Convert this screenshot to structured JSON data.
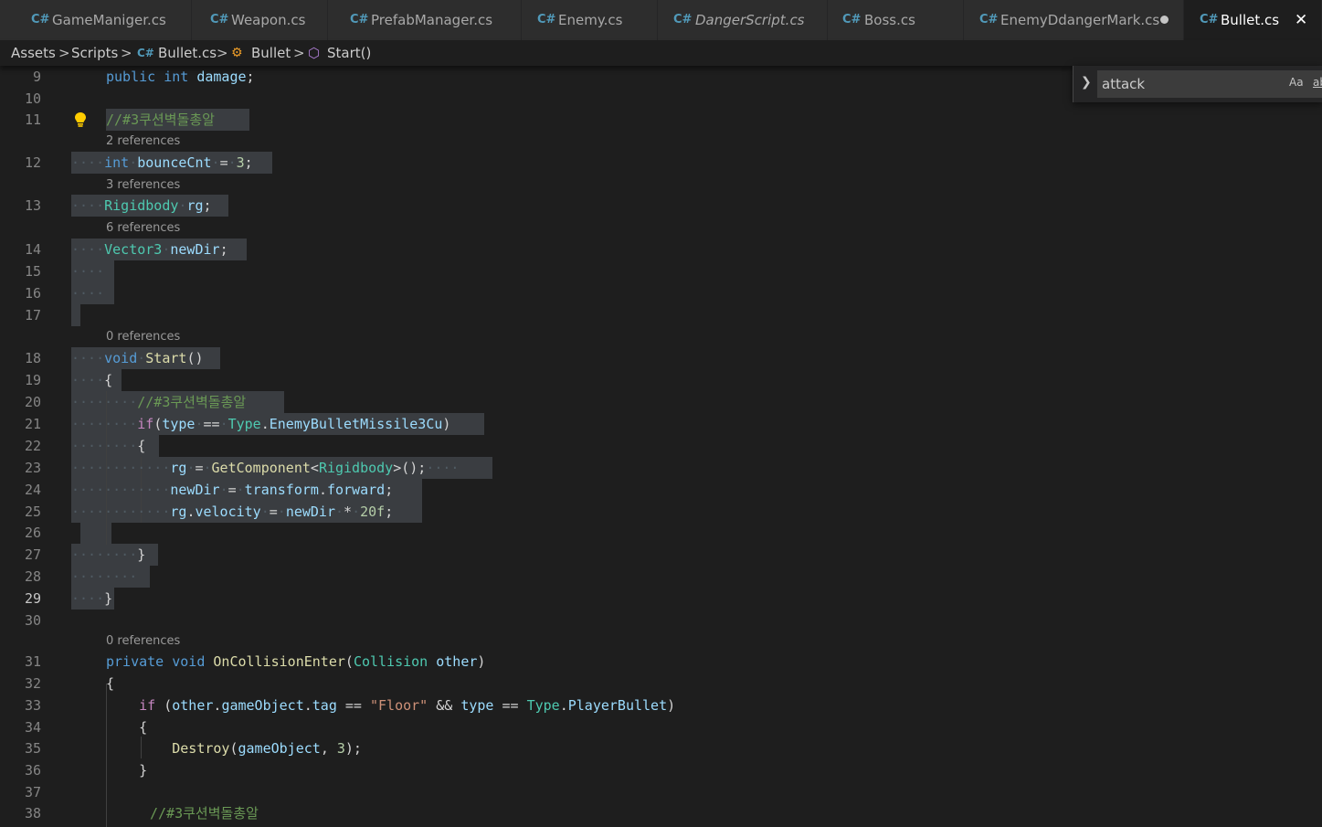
{
  "tabs": [
    {
      "label": "GameManiger.cs",
      "italic": false,
      "active": false
    },
    {
      "label": "Weapon.cs",
      "italic": false,
      "active": false
    },
    {
      "label": "PrefabManager.cs",
      "italic": false,
      "active": false
    },
    {
      "label": "Enemy.cs",
      "italic": false,
      "active": false
    },
    {
      "label": "DangerScript.cs",
      "italic": true,
      "active": false
    },
    {
      "label": "Boss.cs",
      "italic": false,
      "active": false
    },
    {
      "label": "EnemyDdangerMark.cs",
      "italic": false,
      "active": false,
      "modified": true
    },
    {
      "label": "Bullet.cs",
      "italic": false,
      "active": true
    }
  ],
  "tab_close_glyph": "✕",
  "file_icon_text": "C#",
  "breadcrumb": {
    "assets": "Assets",
    "scripts": "Scripts",
    "file": "Bullet.cs",
    "class_name": "Bullet",
    "method": "Start()",
    "separator": ">"
  },
  "find_widget": {
    "value": "attack",
    "match_case_label": "Aa",
    "whole_word_label": "ab"
  },
  "code_lens": {
    "l12": "2 references",
    "l13": "3 references",
    "l14": "6 references",
    "l18": "0 references",
    "l31": "0 references"
  },
  "line_numbers": [
    "9",
    "10",
    "11",
    "12",
    "13",
    "14",
    "15",
    "16",
    "17",
    "18",
    "19",
    "20",
    "21",
    "22",
    "23",
    "24",
    "25",
    "26",
    "27",
    "28",
    "29",
    "30",
    "31",
    "32",
    "33",
    "34",
    "35",
    "36",
    "37",
    "38"
  ],
  "tokens": {
    "l9_kw1": "public",
    "l9_kw2": "int",
    "l9_id": "damage",
    "l11_comment": "//#3쿠션벽돌총알",
    "l12_kw": "int",
    "l12_id": "bounceCnt",
    "l12_num": "3",
    "l13_type": "Rigidbody",
    "l13_id": "rg",
    "l14_type": "Vector3",
    "l14_id": "newDir",
    "l18_kw": "void",
    "l18_fn": "Start",
    "l20_comment": "//#3쿠션벽돌총알",
    "l21_if": "if",
    "l21_type_field": "type",
    "l21_type_class": "Type",
    "l21_member": "EnemyBulletMissile3Cu",
    "l23_id": "rg",
    "l23_fn": "GetComponent",
    "l23_type": "Rigidbody",
    "l24_id": "newDir",
    "l24_obj": "transform",
    "l24_member": "forward",
    "l25_id": "rg",
    "l25_member": "velocity",
    "l25_id2": "newDir",
    "l25_num": "20f",
    "l31_kw1": "private",
    "l31_kw2": "void",
    "l31_fn": "OnCollisionEnter",
    "l31_type": "Collision",
    "l31_param": "other",
    "l33_if": "if",
    "l33_other": "other",
    "l33_go": "gameObject",
    "l33_tag": "tag",
    "l33_str": "\"Floor\"",
    "l33_type_field": "type",
    "l33_type_class": "Type",
    "l33_member": "PlayerBullet",
    "l35_fn": "Destroy",
    "l35_arg": "gameObject",
    "l35_num": "3",
    "l38_comment": "//#3쿠션벽돌총알"
  }
}
